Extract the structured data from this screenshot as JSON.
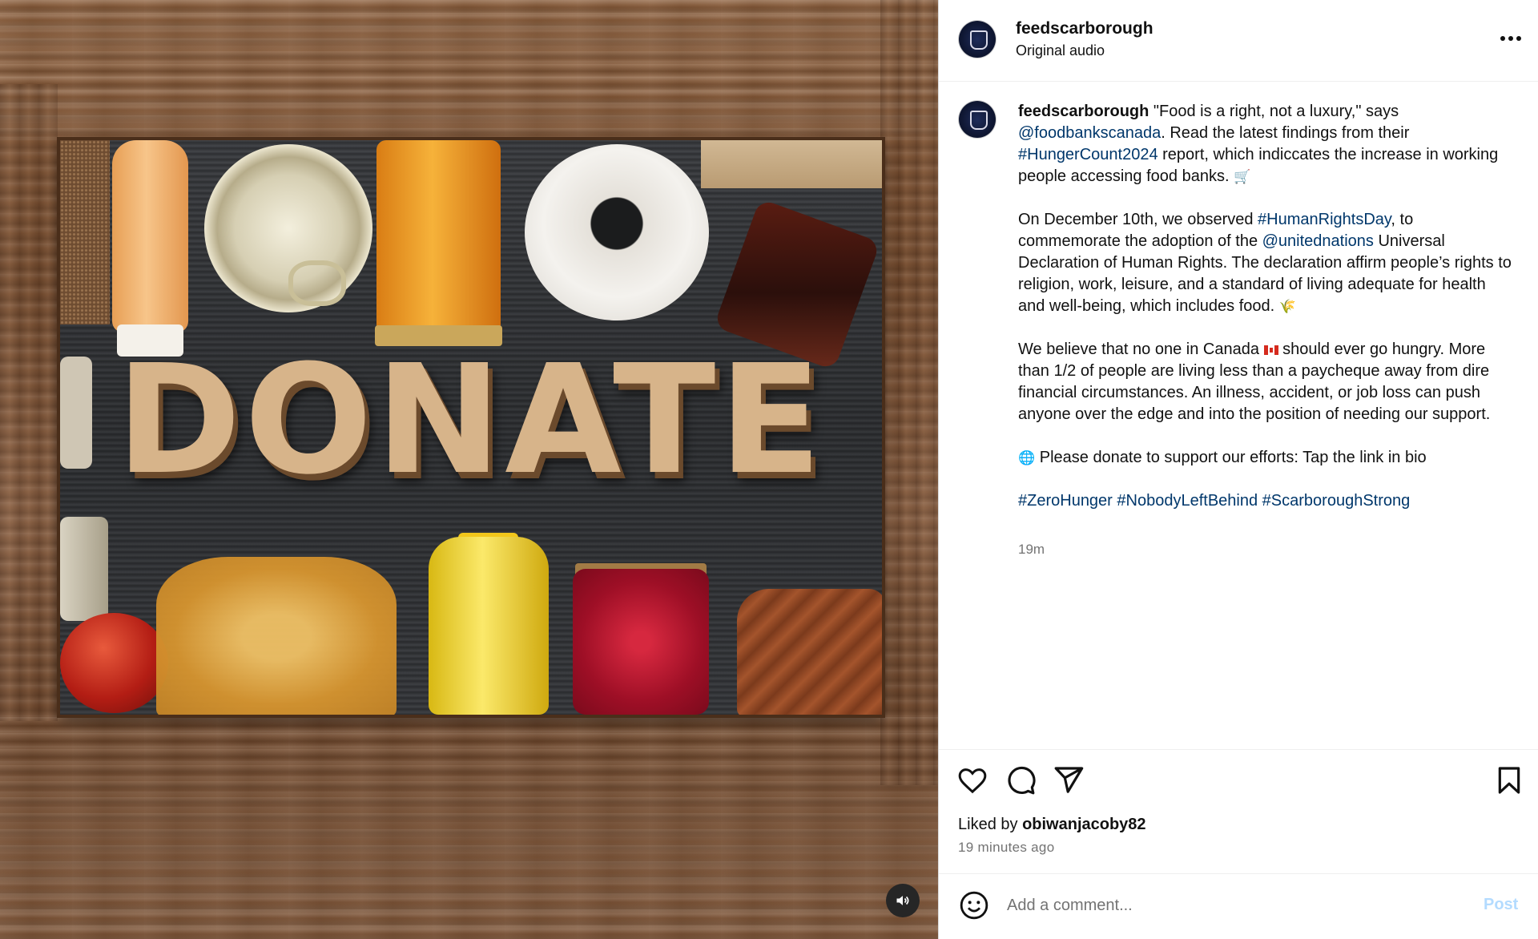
{
  "post": {
    "username": "feedscarborough",
    "audio_label": "Original audio",
    "caption": {
      "p1_lead": " \"Food is a right, not a luxury,\" says ",
      "mention1": "@foodbankscanada",
      "p1_mid": ". Read the latest findings from their ",
      "hashtag1": "#HungerCount2024",
      "p1_tail": " report, which indiccates the increase in working people accessing food banks. ",
      "emoji_cart": "🛒",
      "p2_lead": "On December 10th, we observed ",
      "hashtag2": "#HumanRightsDay",
      "p2_mid": ", to commemorate the adoption of the ",
      "mention2": "@unitednations",
      "p2_tail": " Universal Declaration of Human Rights. The declaration affirm people’s rights to religion, work, leisure, and a standard of living adequate for health and well-being, which includes food. ",
      "emoji_wheat": "🌾",
      "p3_lead": "We believe that no one in Canada ",
      "p3_tail": " should ever go hungry. More than 1/2 of people are living less than a paycheque away from dire financial circumstances. An illness, accident, or job loss can push anyone over the edge and into the position of needing our support.",
      "emoji_globe": "🌐",
      "p4": " Please donate to support our efforts: Tap the link in bio",
      "hashtags": [
        "#ZeroHunger",
        "#NobodyLeftBehind",
        "#ScarboroughStrong"
      ]
    },
    "caption_time": "19m",
    "liked_by_prefix": "Liked by ",
    "liked_by_user": "obiwanjacoby82",
    "relative_time": "19 minutes ago",
    "comment_placeholder": "Add a comment...",
    "post_label": "Post",
    "media_text": "DONATE"
  },
  "icons": {
    "more": "more-options-icon",
    "like": "heart-icon",
    "comment": "comment-bubble-icon",
    "share": "paper-plane-icon",
    "save": "bookmark-icon",
    "emoji": "emoji-smile-icon",
    "sound": "speaker-icon"
  },
  "colors": {
    "link": "#00376b",
    "muted": "#737373",
    "post_button_disabled": "#b3dbff"
  }
}
